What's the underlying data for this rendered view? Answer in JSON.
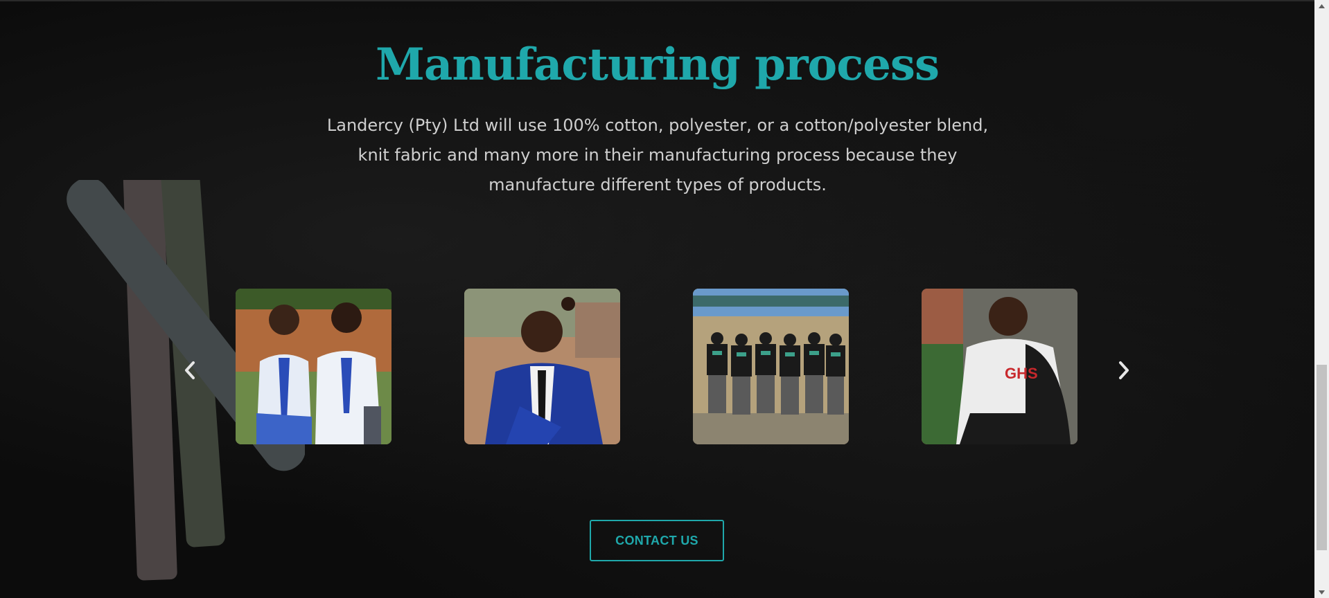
{
  "section": {
    "title": "Manufacturing process",
    "description": "Landercy (Pty) Ltd will use 100% cotton, polyester, or a cotton/polyester blend, knit fabric and many more in their manufacturing process because they manufacture different types of products."
  },
  "carousel": {
    "prev_icon": "chevron-left-icon",
    "next_icon": "chevron-right-icon",
    "slides": [
      {
        "subject": "two students in school uniform"
      },
      {
        "subject": "student in blue blazer"
      },
      {
        "subject": "students in matching jackets"
      },
      {
        "subject": "student in school jacket"
      }
    ]
  },
  "cta": {
    "label": "CONTACT US"
  },
  "colors": {
    "accent": "#1fa8ab",
    "background": "#0c0c0c",
    "text": "#cfcfcf"
  }
}
